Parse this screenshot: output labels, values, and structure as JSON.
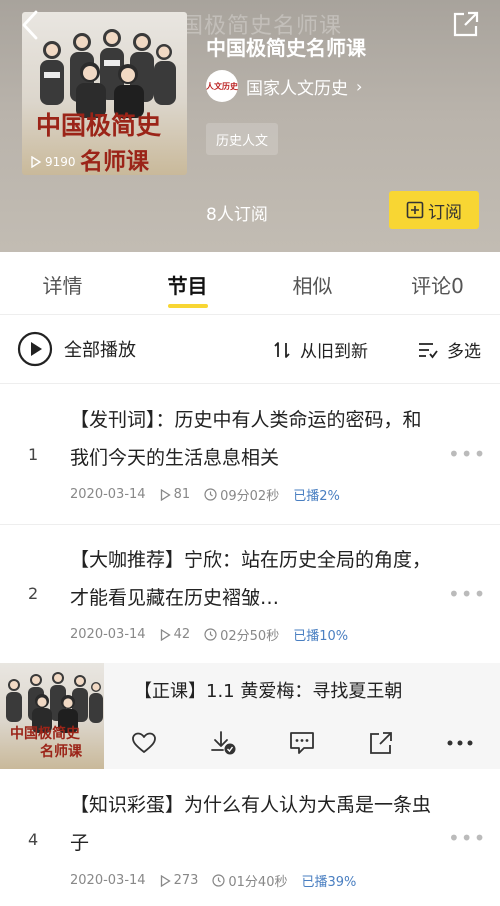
{
  "header": {
    "ghost_title": "中国极简史名师课",
    "album_title": "中国极简史名师课",
    "cover_title_line1": "中国极简史",
    "cover_title_line2": "名师课",
    "play_count": "9190",
    "author": {
      "avatar_text": "人文历史",
      "name": "国家人文历史",
      "arrow": "›"
    },
    "tag": "历史人文",
    "subscribers": "8人订阅",
    "subscribe_label": "订阅"
  },
  "tabs": [
    {
      "label": "详情",
      "active": false
    },
    {
      "label": "节目",
      "active": true
    },
    {
      "label": "相似",
      "active": false
    },
    {
      "label": "评论0",
      "active": false
    }
  ],
  "toolbar": {
    "play_all": "全部播放",
    "sort": "从旧到新",
    "multi_select": "多选"
  },
  "episodes": [
    {
      "num": "1",
      "title": "【发刊词】：历史中有人类命运的密码，和我们今天的生活息息相关",
      "date": "2020-03-14",
      "plays": "81",
      "duration": "09分02秒",
      "progress": "已播2%"
    },
    {
      "num": "2",
      "title": "【大咖推荐】宁欣：站在历史全局的角度，才能看见藏在历史褶皱…",
      "date": "2020-03-14",
      "plays": "42",
      "duration": "02分50秒",
      "progress": "已播10%"
    },
    {
      "num": "4",
      "title": "【知识彩蛋】为什么有人认为大禹是一条虫子",
      "date": "2020-03-14",
      "plays": "273",
      "duration": "01分40秒",
      "progress": "已播39%"
    }
  ],
  "player": {
    "title": "【正课】1.1 黄爱梅：寻找夏王朝",
    "cover_line1": "中国极简史",
    "cover_line2": "名师课"
  },
  "colors": {
    "accent": "#f8d633",
    "played": "#4a7fc1",
    "cover_red": "#9b2418"
  },
  "more_glyph": "•••"
}
